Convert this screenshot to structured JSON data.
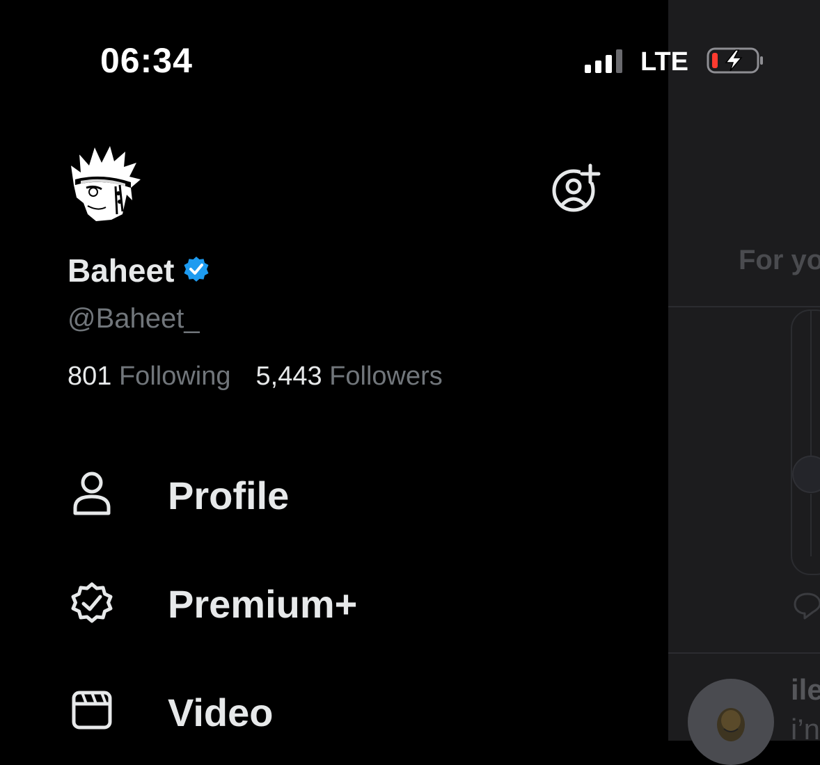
{
  "status_bar": {
    "time": "06:34",
    "network": "LTE"
  },
  "profile": {
    "name": "Baheet",
    "handle": "@Baheet_",
    "following_count": "801",
    "following_label": "Following",
    "followers_count": "5,443",
    "followers_label": "Followers"
  },
  "menu": {
    "items": [
      {
        "label": "Profile",
        "icon": "person-icon"
      },
      {
        "label": "Premium+",
        "icon": "verified-badge-icon"
      },
      {
        "label": "Video",
        "icon": "video-clapper-icon"
      }
    ]
  },
  "background_feed": {
    "tab_label": "For yo",
    "post_author": "ile",
    "post_text": "i’n"
  },
  "colors": {
    "background": "#000000",
    "text_primary": "#e7e9ea",
    "text_secondary": "#71767b",
    "verified_blue": "#1d9bf0",
    "battery_low": "#ff3b30",
    "feed_background": "#1c1c1e"
  }
}
